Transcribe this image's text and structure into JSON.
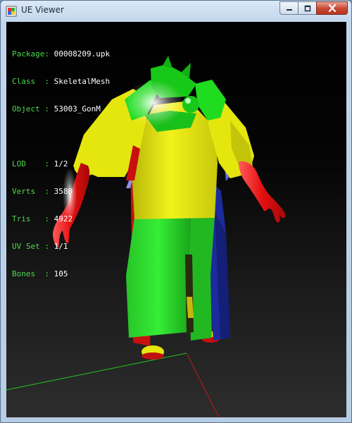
{
  "window": {
    "title": "UE Viewer",
    "buttons": {
      "minimize": "minimize",
      "maximize": "maximize",
      "close": "close"
    }
  },
  "info_panel": {
    "header": [
      {
        "label": "Package: ",
        "value": "00008209.upk"
      },
      {
        "label": "Class  : ",
        "value": "SkeletalMesh"
      },
      {
        "label": "Object : ",
        "value": "53003_GonM"
      }
    ],
    "stats": [
      {
        "label": "LOD    : ",
        "value": "1/2"
      },
      {
        "label": "Verts  : ",
        "value": "3580"
      },
      {
        "label": "Tris   : ",
        "value": "4922"
      },
      {
        "label": "UV Set : ",
        "value": "1/1"
      },
      {
        "label": "Bones  : ",
        "value": "105"
      }
    ]
  },
  "colors": {
    "label_text": "#4dd94d",
    "value_text": "#ffffff",
    "mesh_yellow": "#e6e60f",
    "mesh_green": "#1fdc1f",
    "mesh_red": "#e01010",
    "mesh_blue": "#1c2a9c"
  }
}
